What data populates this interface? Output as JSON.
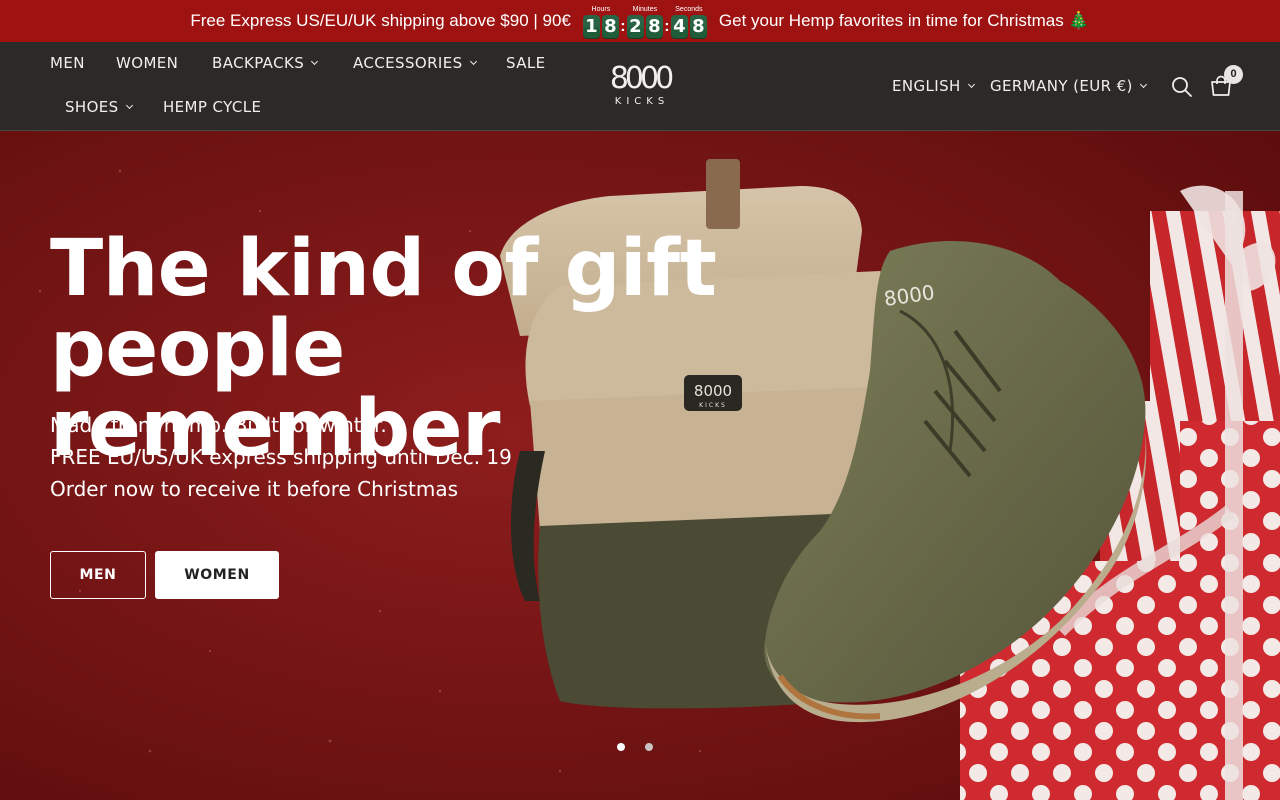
{
  "announcement": {
    "left_text": "Free Express US/EU/UK shipping above $90 | 90€",
    "right_text": "Get your Hemp favorites in time for Christmas 🎄",
    "countdown": {
      "hours_label": "Hours",
      "minutes_label": "Minutes",
      "seconds_label": "Seconds",
      "hours": [
        "1",
        "8"
      ],
      "minutes": [
        "2",
        "8"
      ],
      "seconds": [
        "4",
        "8"
      ]
    },
    "bg_color": "#9e1212",
    "digit_color": "#1f5c3a"
  },
  "nav": {
    "items": [
      {
        "label": "MEN",
        "dropdown": false
      },
      {
        "label": "WOMEN",
        "dropdown": false
      },
      {
        "label": "BACKPACKS",
        "dropdown": true
      },
      {
        "label": "ACCESSORIES",
        "dropdown": true
      },
      {
        "label": "SALE",
        "dropdown": false
      },
      {
        "label": "SHOES",
        "dropdown": true
      },
      {
        "label": "HEMP CYCLE",
        "dropdown": false
      }
    ],
    "logo_number": "8000",
    "logo_text": "KICKS",
    "language": "ENGLISH",
    "country": "GERMANY (EUR €)",
    "cart_count": "0",
    "icons": [
      "search-icon",
      "cart-icon"
    ],
    "bg_color": "#2c2a28"
  },
  "hero": {
    "title_line1": "The kind of gift",
    "title_line2": "people remember",
    "subtitle_line1": "Made from hemp. Built for winter.",
    "subtitle_line2": "FREE EU/US/UK express shipping until Dec. 19",
    "subtitle_line3": "Order now to receive it before Christmas",
    "button_men": "MEN",
    "button_women": "WOMEN",
    "slides": 2,
    "active_slide": 1,
    "backpack_logo_number": "8000",
    "backpack_logo_text": "KICKS"
  }
}
